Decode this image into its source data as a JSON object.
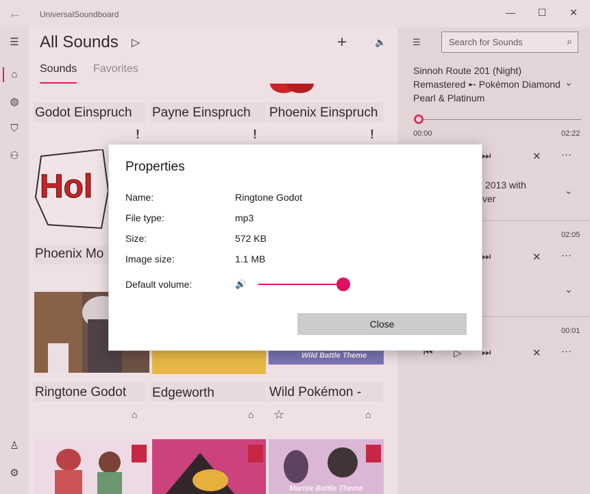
{
  "window": {
    "title": "UniversalSoundboard",
    "back": "←",
    "minimize": "—",
    "maximize": "☐",
    "close": "✕"
  },
  "nav": {
    "menu": "☰",
    "home": "⌂",
    "globe": "◍",
    "shield": "⛉",
    "people": "⚇",
    "account": "♙",
    "settings": "⚙"
  },
  "main": {
    "title": "All Sounds",
    "play": "▷",
    "add": "+",
    "volume": "🔈",
    "tabs": [
      "Sounds",
      "Favorites"
    ],
    "cards": [
      {
        "label": "Godot Einspruch",
        "icon": "!"
      },
      {
        "label": "Payne Einspruch",
        "icon": "!"
      },
      {
        "label": "Phoenix Einspruch",
        "icon": "!"
      },
      {
        "label": "Phoenix Mo",
        "icon": ""
      },
      {
        "label": "Ringtone Godot",
        "icon": "⌂"
      },
      {
        "label": "Edgeworth",
        "icon": "⌂"
      },
      {
        "label": "Wild Pokémon -",
        "icon": "⌂",
        "star": "☆"
      }
    ],
    "image_captions": [
      "Wild Battle Theme",
      "Marnie Battle Theme"
    ]
  },
  "player": {
    "search_placeholder": "Search for Sounds",
    "search_icon": "⌕",
    "list_icon": "☰",
    "track1": "Sinnoh Route 201 (Night) Remastered ➸ Pokémon Diamond Pearl & Platinum",
    "track1_start": "00:00",
    "track1_end": "02:22",
    "track1_progress": 0,
    "track2_fragment_1": "2013 with",
    "track2_fragment_2": "ver",
    "time_2": "02:05",
    "time_3": "00:01",
    "chevron": "⌄",
    "prev": "⏮",
    "play": "▷",
    "next": "⏭",
    "remove": "✕",
    "more": "···"
  },
  "dialog": {
    "title": "Properties",
    "name_label": "Name:",
    "name_value": "Ringtone Godot",
    "type_label": "File type:",
    "type_value": "mp3",
    "size_label": "Size:",
    "size_value": "572 KB",
    "image_size_label": "Image size:",
    "image_size_value": "1.1 MB",
    "volume_label": "Default volume:",
    "volume_icon": "🔊",
    "volume_value": 100,
    "close_label": "Close",
    "accent_color": "#e0115f"
  }
}
